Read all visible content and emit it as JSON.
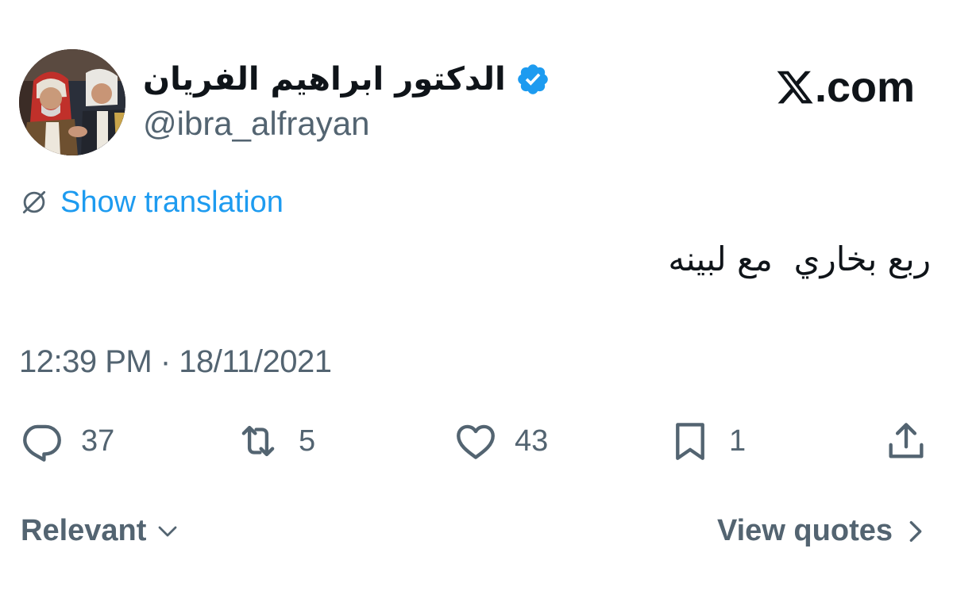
{
  "author": {
    "display_name": "الدكتور ابراهيم الفريان",
    "handle": "@ibra_alfrayan",
    "verified_icon": "verified-badge-icon",
    "avatar": "profile-photo"
  },
  "brand": {
    "logo_icon": "x-logo-icon",
    "domain_suffix": ".com"
  },
  "translation": {
    "icon": "globe-slash-icon",
    "label": "Show translation"
  },
  "tweet": {
    "text": "ربع بخاري  مع لبينه",
    "timestamp": "12:39 PM · 18/11/2021"
  },
  "actions": {
    "replies": {
      "icon": "reply-icon",
      "count": "37"
    },
    "reposts": {
      "icon": "repost-icon",
      "count": "5"
    },
    "likes": {
      "icon": "heart-icon",
      "count": "43"
    },
    "bookmarks": {
      "icon": "bookmark-icon",
      "count": "1"
    },
    "share": {
      "icon": "share-icon"
    }
  },
  "footer": {
    "sort_label": "Relevant",
    "quotes_label": "View quotes"
  },
  "colors": {
    "accent": "#1d9bf0",
    "secondary_text": "#536471",
    "primary_text": "#0f1419"
  }
}
